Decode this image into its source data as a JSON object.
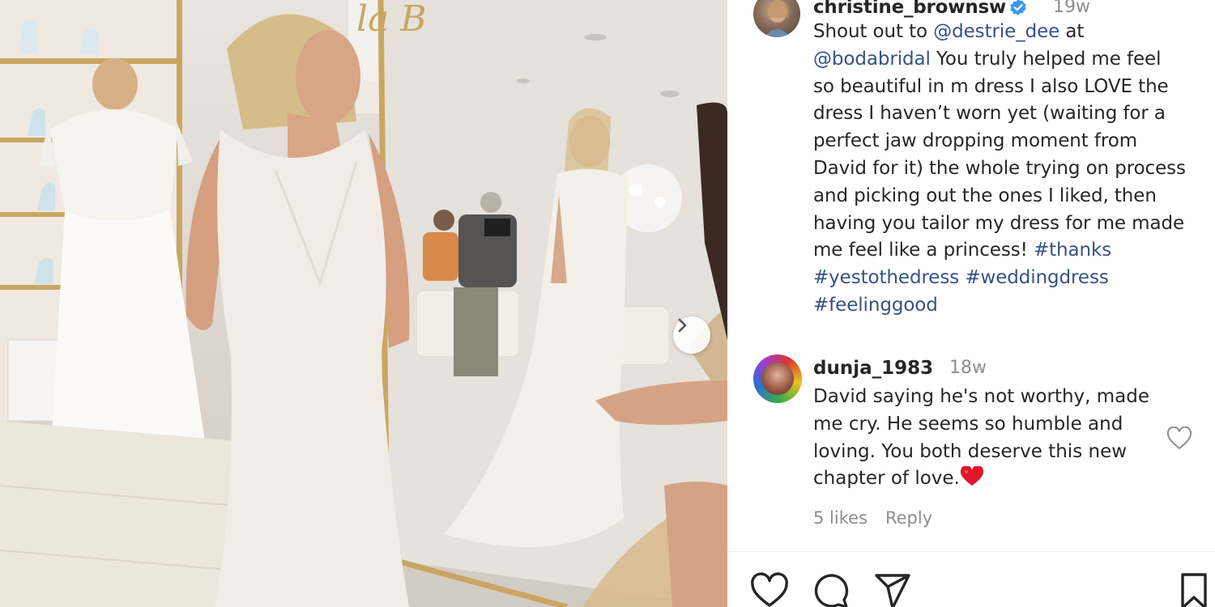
{
  "post": {
    "author": "christine_brownsw",
    "age": "19w",
    "caption_lines": [
      [
        {
          "t": "Shout out to ",
          "link": false
        },
        {
          "t": "@destrie_dee",
          "link": true
        },
        {
          "t": " at",
          "link": false
        }
      ],
      [
        {
          "t": "@bodabridal",
          "link": true
        },
        {
          "t": " You truly helped me feel",
          "link": false
        }
      ],
      [
        {
          "t": "so beautiful in m dress I also LOVE the",
          "link": false
        }
      ],
      [
        {
          "t": "dress I haven’t worn yet (waiting for a",
          "link": false
        }
      ],
      [
        {
          "t": "perfect jaw dropping moment from",
          "link": false
        }
      ],
      [
        {
          "t": "David for it) the whole trying on process",
          "link": false
        }
      ],
      [
        {
          "t": "and picking out the ones I liked, then",
          "link": false
        }
      ],
      [
        {
          "t": "having you tailor my dress for me made",
          "link": false
        }
      ],
      [
        {
          "t": "me feel like a princess! ",
          "link": false
        },
        {
          "t": "#thanks",
          "link": true
        }
      ],
      [
        {
          "t": "#yestothedress",
          "link": true
        },
        {
          "t": " ",
          "link": false
        },
        {
          "t": "#weddingdress",
          "link": true
        }
      ],
      [
        {
          "t": "#feelinggood",
          "link": true
        }
      ]
    ]
  },
  "comment": {
    "user": "dunja_1983",
    "age": "18w",
    "lines": [
      "David saying he's not worthy, made",
      "me cry. He seems so humble and",
      "loving. You both deserve this new",
      "chapter of love."
    ],
    "likes": "5 likes",
    "reply": "Reply"
  },
  "icons": {
    "verified": "verified-badge-icon",
    "next": "chevron-right-icon",
    "comment_like": "heart-outline-icon",
    "like": "heart-outline-icon",
    "comment": "speech-bubble-icon",
    "share": "paper-plane-icon",
    "save": "bookmark-icon"
  },
  "colors": {
    "link": "#385185",
    "verified": "#3897f0",
    "muted": "#8e8e8e",
    "heart_emoji": "#e0162b"
  }
}
